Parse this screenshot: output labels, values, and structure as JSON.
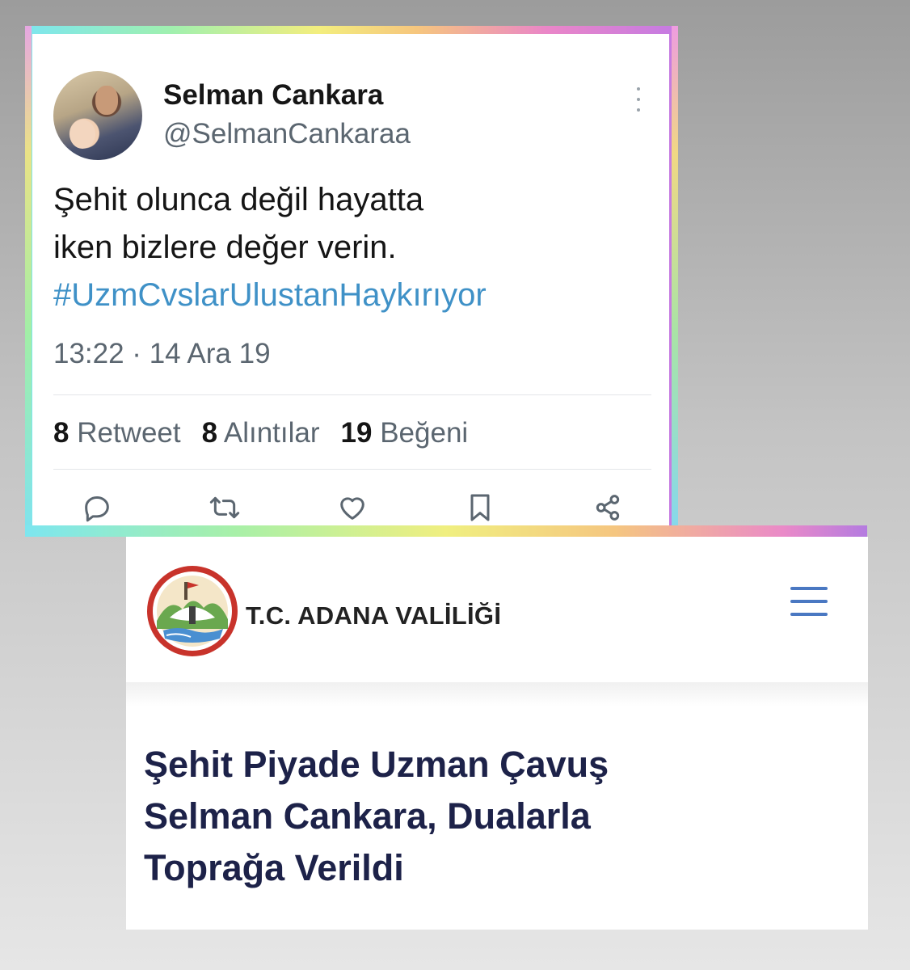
{
  "tweet": {
    "user_name": "Selman Cankara",
    "user_handle": "@SelmanCankaraa",
    "text_line1": "Şehit olunca değil hayatta",
    "text_line2": "iken bizlere değer verin.",
    "hashtag": "#UzmCvslarUlustanHaykırıyor",
    "time": "13:22 · 14 Ara 19",
    "stats": {
      "retweets_count": "8",
      "retweets_label": "Retweet",
      "quotes_count": "8",
      "quotes_label": "Alıntılar",
      "likes_count": "19",
      "likes_label": "Beğeni"
    },
    "actions": [
      "reply-icon",
      "retweet-icon",
      "like-icon",
      "bookmark-icon",
      "share-icon"
    ],
    "colors": {
      "hashtag": "#3f91c7",
      "secondary_text": "#5b6670"
    }
  },
  "governorate": {
    "site_title": "T.C. ADANA VALİLİĞİ",
    "logo_icon": "adana-governorate-seal",
    "menu_icon": "hamburger-menu-icon",
    "headline_line1": "Şehit Piyade Uzman Çavuş",
    "headline_line2": "Selman Cankara, Dualarla",
    "headline_line3": "Toprağa Verildi",
    "colors": {
      "headline": "#1d2249",
      "menu": "#4a78c2",
      "seal": "#c8332b"
    }
  }
}
